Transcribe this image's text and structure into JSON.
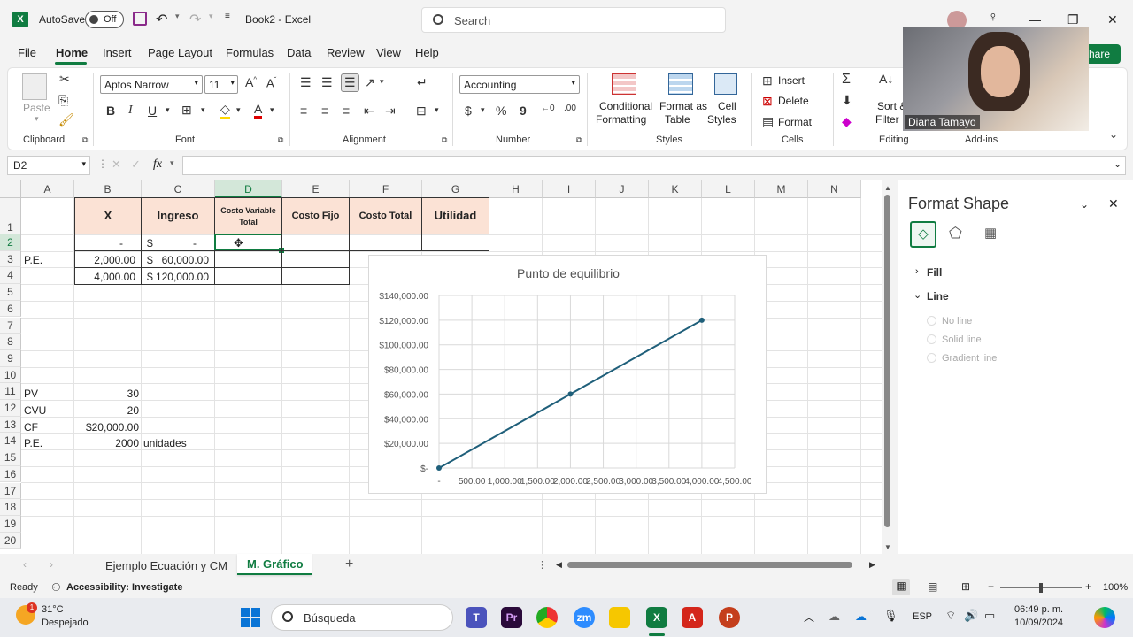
{
  "titlebar": {
    "autosave_label": "AutoSave",
    "autosave_state": "Off",
    "doc_title": "Book2 - Excel",
    "search_placeholder": "Search"
  },
  "menu": [
    "File",
    "Home",
    "Insert",
    "Page Layout",
    "Formulas",
    "Data",
    "Review",
    "View",
    "Help"
  ],
  "share_label": "hare",
  "ribbon": {
    "clipboard": {
      "paste": "Paste",
      "label": "Clipboard"
    },
    "font": {
      "name": "Aptos Narrow",
      "size": "11",
      "label": "Font"
    },
    "alignment": {
      "label": "Alignment"
    },
    "number": {
      "format": "Accounting",
      "label": "Number"
    },
    "styles": {
      "conditional": "Conditional",
      "conditional2": "Formatting",
      "format_as": "Format as",
      "format_as2": "Table",
      "cell": "Cell",
      "cell2": "Styles",
      "label": "Styles"
    },
    "cells": {
      "insert": "Insert",
      "delete": "Delete",
      "format": "Format",
      "label": "Cells"
    },
    "editing": {
      "sort": "Sort &",
      "filter": "Filter",
      "label": "Editing"
    },
    "addins": {
      "label": "Add-ins"
    }
  },
  "webcam": {
    "name": "Diana Tamayo"
  },
  "formula_bar": {
    "namebox": "D2",
    "fx": "fx",
    "value": ""
  },
  "columns": [
    "A",
    "B",
    "C",
    "D",
    "E",
    "F",
    "G",
    "H",
    "I",
    "J",
    "K",
    "L",
    "M",
    "N"
  ],
  "rows": [
    "1",
    "2",
    "3",
    "4",
    "5",
    "6",
    "7",
    "8",
    "9",
    "10",
    "11",
    "12",
    "13",
    "14",
    "15",
    "16",
    "17",
    "18",
    "19",
    "20"
  ],
  "table": {
    "headers": {
      "x": "X",
      "ingreso": "Ingreso",
      "cvt1": "Costo Variable",
      "cvt2": "Total",
      "cf": "Costo Fijo",
      "ct": "Costo Total",
      "util": "Utilidad"
    },
    "r2": {
      "b": "-",
      "c_cur": "$",
      "c": "-"
    },
    "r3": {
      "a": "P.E.",
      "b": "2,000.00",
      "c_cur": "$",
      "c": "60,000.00"
    },
    "r4": {
      "b": "4,000.00",
      "c_cur": "$",
      "c": "120,000.00"
    }
  },
  "params": {
    "r11": {
      "a": "PV",
      "b": "30"
    },
    "r12": {
      "a": "CVU",
      "b": "20"
    },
    "r13": {
      "a": "CF",
      "b": "$20,000.00"
    },
    "r14": {
      "a": "P.E.",
      "b": "2000",
      "c": "unidades"
    }
  },
  "chart_data": {
    "type": "line",
    "title": "Punto de equilibrio",
    "x": [
      0,
      2000,
      4000
    ],
    "values": [
      0,
      60000,
      120000
    ],
    "x_ticks": [
      "-",
      "500.00",
      "1,000.00",
      "1,500.00",
      "2,000.00",
      "2,500.00",
      "3,000.00",
      "3,500.00",
      "4,000.00",
      "4,500.00"
    ],
    "y_ticks": [
      "$-",
      "$20,000.00",
      "$40,000.00",
      "$60,000.00",
      "$80,000.00",
      "$100,000.00",
      "$120,000.00",
      "$140,000.00"
    ],
    "xlim": [
      0,
      4500
    ],
    "ylim": [
      0,
      140000
    ],
    "grid": true,
    "color": "#1f5f7a"
  },
  "pane": {
    "title": "Format Shape",
    "fill": "Fill",
    "line": "Line",
    "options": [
      "No line",
      "Solid line",
      "Gradient line"
    ]
  },
  "sheets": {
    "tab1": "Ejemplo Ecuación y CM",
    "tab2": "M. Gráfico"
  },
  "status": {
    "ready": "Ready",
    "accessibility": "Accessibility: Investigate",
    "zoom": "100%"
  },
  "taskbar": {
    "temp": "31°C",
    "weather": "Despejado",
    "search": "Búsqueda",
    "lang": "ESP",
    "time": "06:49 p. m.",
    "date": "10/09/2024"
  }
}
